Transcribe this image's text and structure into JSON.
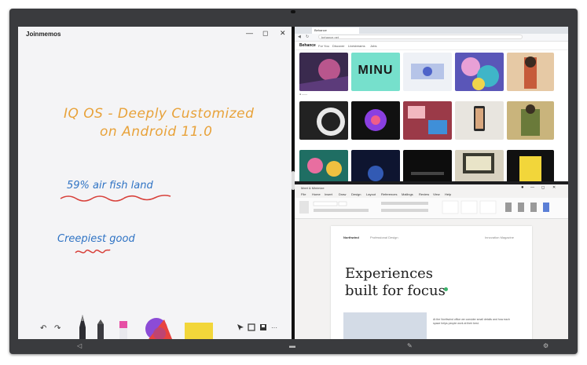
{
  "memo": {
    "app_title": "Joinmemos",
    "window_controls": {
      "minimize": "—",
      "restore": "◻",
      "close": "✕"
    },
    "ink_line1": "IQ OS - Deeply Customized",
    "ink_line2": "on Android 11.0",
    "ink_note1": "59% air fish land",
    "ink_note2": "Creepiest good",
    "toolbar": {
      "undo": "↶",
      "redo": "↷",
      "more": "···"
    }
  },
  "browser": {
    "tab_label": "Behance",
    "url": "behance.net",
    "nav": {
      "logo": "Behance",
      "items": [
        "For You",
        "Discover",
        "Livestreams",
        "Jobs"
      ]
    },
    "tile_wordmark": "MINU",
    "tile_colors": [
      "#3a2a4e",
      "#76e0cc",
      "#eef1f6",
      "#5a56b8",
      "#e6c9a5",
      "#222222",
      "#111111",
      "#9b3a48",
      "#e8e5df",
      "#c9b47c",
      "#1f6e63",
      "#0e1530",
      "#0d0d0d",
      "#d8d2c0",
      "#111111"
    ]
  },
  "word": {
    "window_title": "Meet & Minimize",
    "menu": [
      "File",
      "Home",
      "Insert",
      "Draw",
      "Design",
      "Layout",
      "References",
      "Mailings",
      "Review",
      "View",
      "Help"
    ],
    "doc": {
      "brand": "Northwind",
      "nav": "Professional Design",
      "right_label": "Innovation Magazine",
      "heading_line1": "Experiences",
      "heading_line2": "built for focus",
      "body": "At the Northwind office we consider small details and how each space helps people work at their best."
    }
  },
  "colors": {
    "ink_orange": "#e8a23a",
    "ink_blue": "#2f73c4",
    "ink_red": "#d8403a"
  }
}
